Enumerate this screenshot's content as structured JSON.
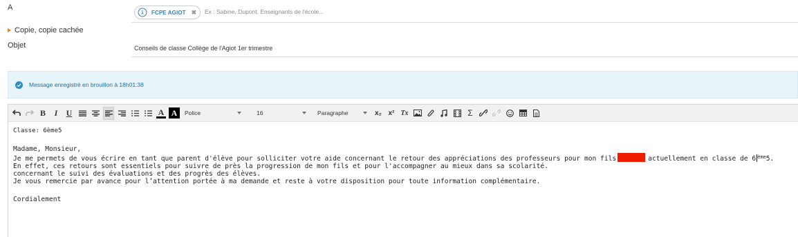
{
  "fields": {
    "to_label": "A",
    "recipient_chip": "FCPE AGIOT",
    "recipient_remove": "✖",
    "recipient_placeholder": "Ex : Sabine, Dupont, Enseignants de l'école...",
    "cc_label": "Copie, copie cachée",
    "subject_label": "Objet",
    "subject_value": "Conseils de classe Collège de l'Agiot 1er trimestre"
  },
  "banner": {
    "text": "Message enregistré en brouillon à 18h01:38"
  },
  "toolbar": {
    "bold": "B",
    "italic": "I",
    "underline": "U",
    "font_color": "A",
    "bg_color": "A",
    "font_family": "Police",
    "font_size": "16",
    "format": "Paragraphe",
    "subscript": "x₂",
    "superscript": "x²",
    "clear_format": "Tx",
    "sigma": "Σ"
  },
  "body": {
    "class_line": "Classe: 6ème5",
    "greeting": "Madame, Monsieur,",
    "line1_a": "Je me permets de vous écrire en tant que parent d'élève pour solliciter votre aide concernant le retour des appréciations des professeurs pour mon fils",
    "line1_b": "actuellement en classe de 6",
    "line1_sup": "ème",
    "line1_c": "5.",
    "line2": "En effet, ces retours sont essentiels pour suivre de près la progression de mon fils et pour l'accompagner au mieux dans sa scolarité.",
    "line3": "concernant le suivi des évaluations et des progrès des élèves.",
    "line4": "Je vous remercie par avance pour l’attention portée à ma demande et reste à votre disposition pour toute information complémentaire.",
    "closing": "Cordialement"
  },
  "colors": {
    "accent": "#3a7fb8",
    "banner_bg": "#e7f4fa",
    "cc_arrow": "#e8881c",
    "redaction": "#ee1c00"
  }
}
